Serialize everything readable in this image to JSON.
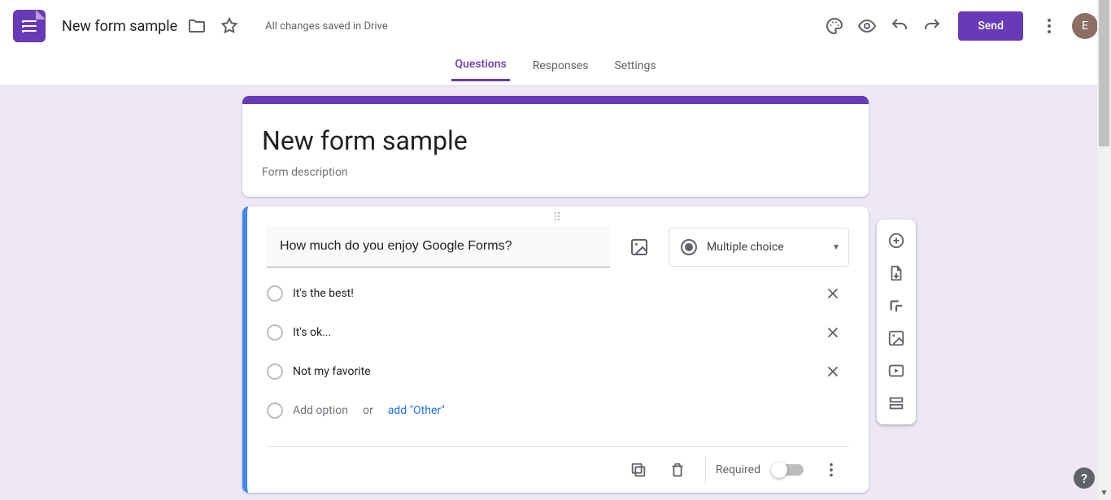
{
  "header": {
    "doc_title": "New form sample",
    "save_status": "All changes saved in Drive",
    "send_label": "Send",
    "avatar_letter": "E"
  },
  "tabs": {
    "questions": "Questions",
    "responses": "Responses",
    "settings": "Settings"
  },
  "form": {
    "title": "New form sample",
    "description_placeholder": "Form description"
  },
  "question": {
    "text": "How much do you enjoy Google Forms?",
    "type_label": "Multiple choice",
    "options": [
      "It's the best!",
      "It's ok...",
      "Not my favorite"
    ],
    "add_option": "Add option",
    "or": "or",
    "add_other": "add \"Other\"",
    "required_label": "Required"
  }
}
